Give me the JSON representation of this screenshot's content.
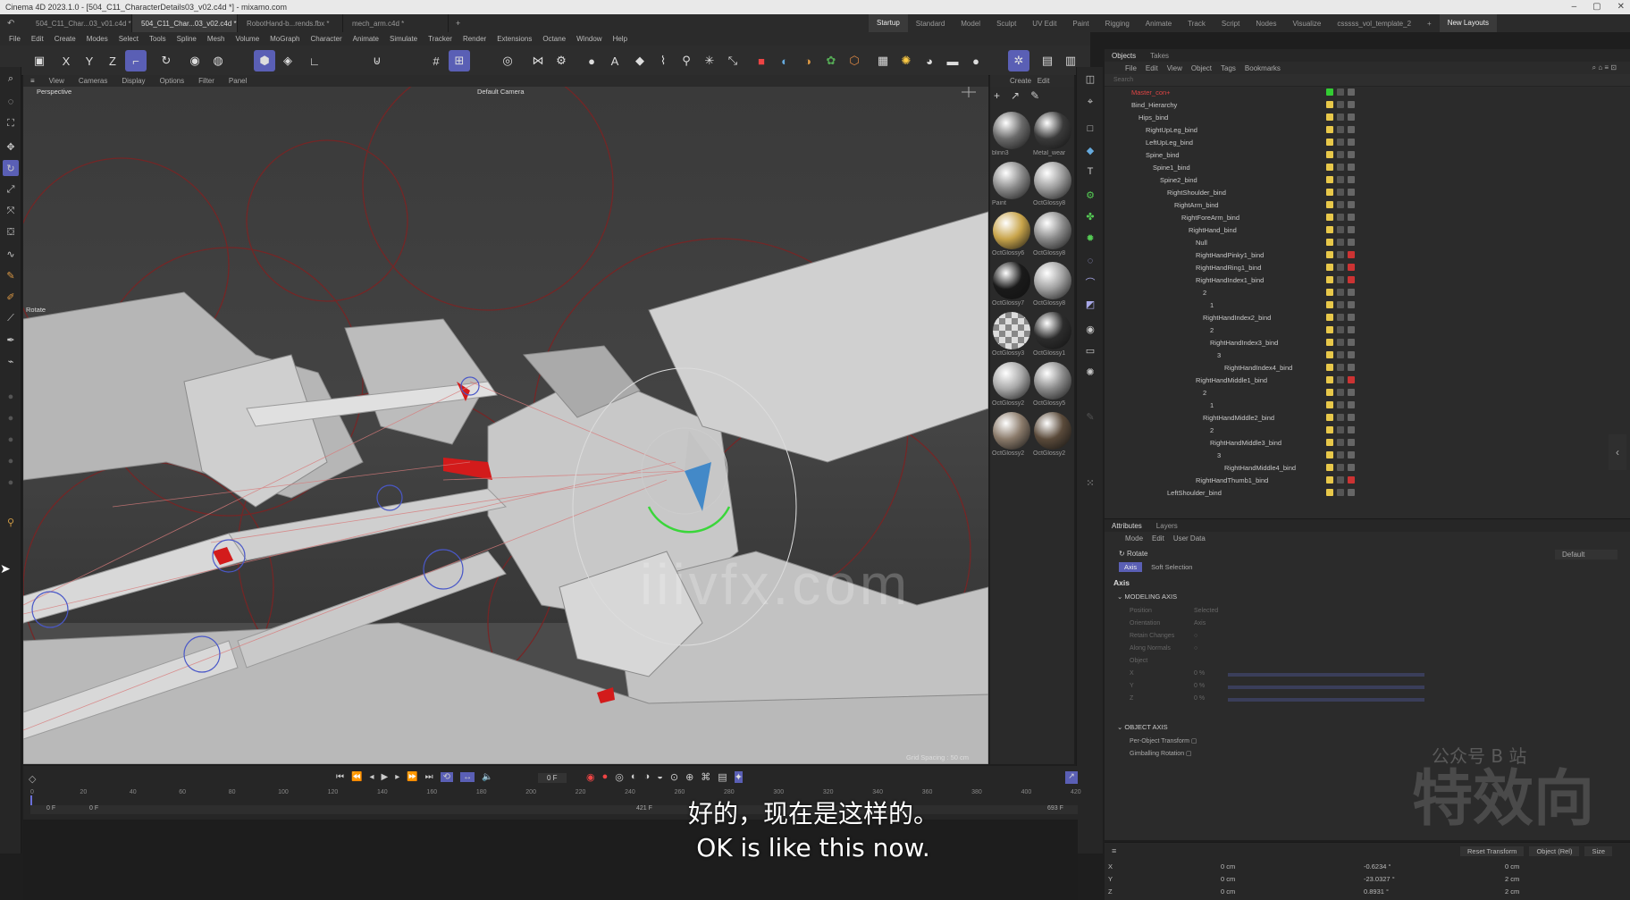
{
  "title_bar": {
    "text": "Cinema 4D 2023.1.0 - [504_C11_CharacterDetails03_v02.c4d *] - mixamo.com"
  },
  "doc_tabs": [
    {
      "label": "504_C11_Char...03_v01.c4d *",
      "active": false
    },
    {
      "label": "504_C11_Char...03_v02.c4d *",
      "active": true
    },
    {
      "label": "RobotHand-b...rends.fbx *",
      "active": false
    },
    {
      "label": "mech_arm.c4d *",
      "active": false
    }
  ],
  "layouts": [
    "Startup",
    "Standard",
    "Model",
    "Sculpt",
    "UV Edit",
    "Paint",
    "Rigging",
    "Animate",
    "Track",
    "Script",
    "Nodes",
    "Visualize",
    "csssss_vol_template_2"
  ],
  "new_layouts": "New Layouts",
  "menu": [
    "File",
    "Edit",
    "Create",
    "Modes",
    "Select",
    "Tools",
    "Spline",
    "Mesh",
    "Volume",
    "MoGraph",
    "Character",
    "Animate",
    "Simulate",
    "Tracker",
    "Render",
    "Extensions",
    "Octane",
    "Window",
    "Help"
  ],
  "viewport": {
    "menu": [
      "View",
      "Cameras",
      "Display",
      "Options",
      "Filter",
      "Panel"
    ],
    "label": "Perspective",
    "camera": "Default Camera",
    "mode_label": "Rotate",
    "grid_spacing": "Grid Spacing : 50 cm"
  },
  "materials": {
    "menu": [
      "Create",
      "Edit"
    ],
    "items": [
      {
        "label": "blinn3",
        "color": "#6a6a6a"
      },
      {
        "label": "Metal_wear",
        "color": "#3a3a3a"
      },
      {
        "label": "Paint",
        "color": "#8a8a8a"
      },
      {
        "label": "OctGlossy8",
        "color": "#9a9a9a"
      },
      {
        "label": "OctGlossy6",
        "color": "#c8a44a"
      },
      {
        "label": "OctGlossy8",
        "color": "#8a8a8a"
      },
      {
        "label": "OctGlossy7",
        "color": "#1a1a1a"
      },
      {
        "label": "OctGlossy8",
        "color": "#a0a0a0"
      },
      {
        "label": "OctGlossy3",
        "color": "#cfcfcf"
      },
      {
        "label": "OctGlossy1",
        "color": "#2c2c2c"
      },
      {
        "label": "OctGlossy2",
        "color": "#a8a8a8"
      },
      {
        "label": "OctGlossy5",
        "color": "#8a8a8a"
      },
      {
        "label": "OctGlossy2",
        "color": "#8a7a6a"
      },
      {
        "label": "OctGlossy2",
        "color": "#5a4a3a"
      }
    ]
  },
  "objects_panel": {
    "tabs": [
      "Objects",
      "Takes"
    ],
    "menu": [
      "File",
      "Edit",
      "View",
      "Object",
      "Tags",
      "Bookmarks"
    ],
    "search_placeholder": "Search",
    "rows": [
      {
        "name": "Master_con+",
        "indent": 0,
        "color": "#d44"
      },
      {
        "name": "Bind_Hierarchy",
        "indent": 0
      },
      {
        "name": "Hips_bind",
        "indent": 1
      },
      {
        "name": "RightUpLeg_bind",
        "indent": 2
      },
      {
        "name": "LeftUpLeg_bind",
        "indent": 2
      },
      {
        "name": "Spine_bind",
        "indent": 2
      },
      {
        "name": "Spine1_bind",
        "indent": 3
      },
      {
        "name": "Spine2_bind",
        "indent": 4
      },
      {
        "name": "RightShoulder_bind",
        "indent": 5
      },
      {
        "name": "RightArm_bind",
        "indent": 6
      },
      {
        "name": "RightForeArm_bind",
        "indent": 7
      },
      {
        "name": "RightHand_bind",
        "indent": 8
      },
      {
        "name": "Null",
        "indent": 9
      },
      {
        "name": "RightHandPinky1_bind",
        "indent": 9
      },
      {
        "name": "RightHandRing1_bind",
        "indent": 9
      },
      {
        "name": "RightHandIndex1_bind",
        "indent": 9
      },
      {
        "name": "2",
        "indent": 10
      },
      {
        "name": "1",
        "indent": 11
      },
      {
        "name": "RightHandIndex2_bind",
        "indent": 10
      },
      {
        "name": "2",
        "indent": 11
      },
      {
        "name": "RightHandIndex3_bind",
        "indent": 11
      },
      {
        "name": "3",
        "indent": 12
      },
      {
        "name": "RightHandIndex4_bind",
        "indent": 13
      },
      {
        "name": "RightHandMiddle1_bind",
        "indent": 9
      },
      {
        "name": "2",
        "indent": 10
      },
      {
        "name": "1",
        "indent": 11
      },
      {
        "name": "RightHandMiddle2_bind",
        "indent": 10
      },
      {
        "name": "2",
        "indent": 11
      },
      {
        "name": "RightHandMiddle3_bind",
        "indent": 11
      },
      {
        "name": "3",
        "indent": 12
      },
      {
        "name": "RightHandMiddle4_bind",
        "indent": 13
      },
      {
        "name": "RightHandThumb1_bind",
        "indent": 9
      },
      {
        "name": "LeftShoulder_bind",
        "indent": 5
      }
    ]
  },
  "attributes": {
    "tabs": [
      "Attributes",
      "Layers"
    ],
    "menu": [
      "Mode",
      "Edit",
      "User Data"
    ],
    "preset": "Default",
    "tool_name": "Rotate",
    "subtabs": [
      "Axis",
      "Soft Selection"
    ],
    "section": "Axis",
    "group1": "MODELING AXIS",
    "g1_rows": [
      "Position",
      "Orientation",
      "Retain Changes",
      "Along Normals",
      "Object"
    ],
    "g1_vals": [
      "Selected",
      "Axis"
    ],
    "xyz": [
      "X",
      "Y",
      "Z"
    ],
    "pcts": [
      "0 %",
      "0 %",
      "0 %"
    ],
    "group2": "OBJECT AXIS",
    "g2_rows": [
      "Per-Object Transform",
      "Gimballing Rotation"
    ]
  },
  "coords": {
    "buttons": [
      "Reset Transform",
      "Object (Rel)",
      "Size"
    ],
    "rows": [
      {
        "axis": "X",
        "pos": "0 cm",
        "rot": "-0.6234 °",
        "size": "0 cm"
      },
      {
        "axis": "Y",
        "pos": "0 cm",
        "rot": "-23.0327 °",
        "size": "2 cm"
      },
      {
        "axis": "Z",
        "pos": "0 cm",
        "rot": "0.8931 °",
        "size": "2 cm"
      }
    ]
  },
  "timeline": {
    "frame": "0 F",
    "ticks": [
      "0",
      "20",
      "40",
      "60",
      "80",
      "100",
      "120",
      "140",
      "160",
      "180",
      "200",
      "220",
      "240",
      "260",
      "280",
      "300",
      "320",
      "340",
      "360",
      "380",
      "400",
      "420"
    ],
    "start": "0 F",
    "start2": "0 F",
    "mid": "421 F",
    "end": "693 F"
  },
  "subtitles": {
    "zh": "好的，现在是这样的。",
    "en": "OK is like this now."
  },
  "watermark": {
    "line1": "公众号 B 站",
    "line2": "特效向",
    "mid": "iiivfx.com"
  }
}
